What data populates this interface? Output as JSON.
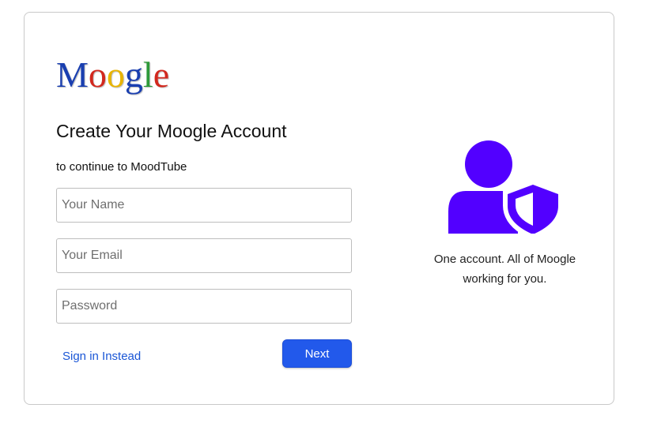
{
  "logo": {
    "letters": [
      {
        "char": "M",
        "color": "#1a3fb0"
      },
      {
        "char": "o",
        "color": "#d2281e"
      },
      {
        "char": "o",
        "color": "#e8b400"
      },
      {
        "char": "g",
        "color": "#1a3fb0"
      },
      {
        "char": "l",
        "color": "#2e9a3a"
      },
      {
        "char": "e",
        "color": "#d2281e"
      }
    ]
  },
  "form": {
    "title": "Create Your Moogle Account",
    "subtitle": "to continue to MoodTube",
    "name_placeholder": "Your Name",
    "email_placeholder": "Your Email",
    "password_placeholder": "Password",
    "signin_label": "Sign in Instead",
    "next_label": "Next"
  },
  "side": {
    "icon": "user-shield-icon",
    "icon_color": "#5200ff",
    "tagline_line1": "One account. All of Moogle",
    "tagline_line2": "working for you."
  },
  "colors": {
    "accent": "#2259eb",
    "link": "#1a56d6"
  }
}
